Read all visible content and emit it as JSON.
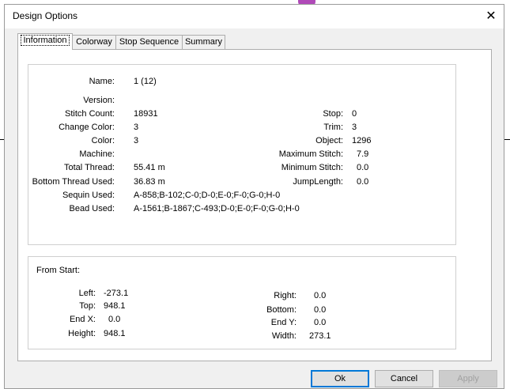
{
  "window": {
    "title": "Design Options",
    "close_symbol": "✕"
  },
  "tabs": [
    "Information",
    "Colorway",
    "Stop Sequence",
    "Summary"
  ],
  "info": {
    "name": {
      "label": "Name:",
      "value": "1 (12)"
    },
    "version": {
      "label": "Version:",
      "value": ""
    },
    "stitch_count": {
      "label": "Stitch Count:",
      "value": "18931"
    },
    "change_color": {
      "label": "Change Color:",
      "value": "3"
    },
    "color": {
      "label": "Color:",
      "value": "3"
    },
    "machine": {
      "label": "Machine:",
      "value": ""
    },
    "total_thread": {
      "label": "Total Thread:",
      "value": "55.41 m"
    },
    "bottom_thread": {
      "label": "Bottom Thread Used:",
      "value": "36.83 m"
    },
    "sequin": {
      "label": "Sequin Used:",
      "value": "A-858;B-102;C-0;D-0;E-0;F-0;G-0;H-0"
    },
    "bead": {
      "label": "Bead Used:",
      "value": "A-1561;B-1867;C-493;D-0;E-0;F-0;G-0;H-0"
    },
    "stop": {
      "label": "Stop:",
      "value": "0"
    },
    "trim": {
      "label": "Trim:",
      "value": "3"
    },
    "object": {
      "label": "Object:",
      "value": "1296"
    },
    "max_stitch": {
      "label": "Maximum Stitch:",
      "value": "7.9"
    },
    "min_stitch": {
      "label": "Minimum Stitch:",
      "value": "0.0"
    },
    "jump_length": {
      "label": "JumpLength:",
      "value": "0.0"
    }
  },
  "from_start": {
    "heading": "From Start:",
    "left": {
      "label": "Left:",
      "value": "-273.1"
    },
    "top": {
      "label": "Top:",
      "value": "948.1"
    },
    "end_x": {
      "label": "End X:",
      "value": "0.0"
    },
    "height": {
      "label": "Height:",
      "value": "948.1"
    },
    "right": {
      "label": "Right:",
      "value": "0.0"
    },
    "bottom": {
      "label": "Bottom:",
      "value": "0.0"
    },
    "end_y": {
      "label": "End Y:",
      "value": "0.0"
    },
    "width": {
      "label": "Width:",
      "value": "273.1"
    }
  },
  "buttons": {
    "ok": "Ok",
    "cancel": "Cancel",
    "apply": "Apply"
  }
}
